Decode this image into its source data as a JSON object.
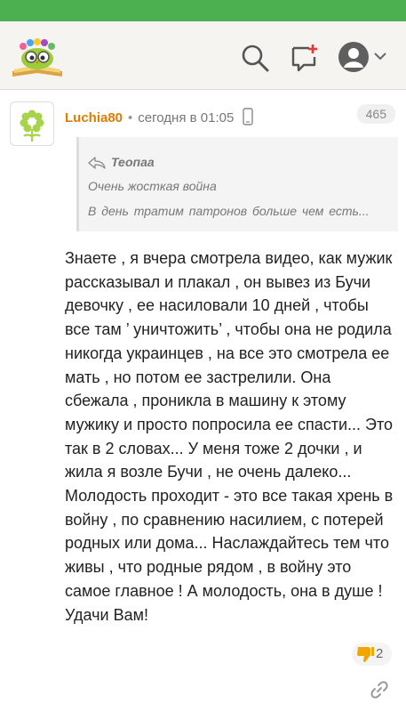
{
  "colors": {
    "status_bar": "#4caf50",
    "header_bg": "#f6f4f1",
    "author": "#e07b00",
    "text": "#222222",
    "meta": "#777777",
    "like_thumb": "#f2a400"
  },
  "header": {
    "icons": [
      "logo-owl-book",
      "search-icon",
      "add-comment-icon",
      "profile-avatar-icon",
      "chevron-down-icon"
    ]
  },
  "post": {
    "author": "Luchia80",
    "time": "сегодня в 01:05",
    "device_icon": "phone-icon",
    "badge": "465",
    "quote": {
      "author": "Теопаа",
      "line1": "Очень жосткая война",
      "line2": "В день тратим патронов больше чем есть..."
    },
    "body": "Знаете , я вчера смотрела видео, как мужик рассказывал и плакал , он вывез из Бучи девочку , ее насиловали 10 дней , чтобы все там ’ уничтожить’ , чтобы она не родила никогда украинцев , на все это смотрела ее мать , но потом ее застрелили. Она сбежала , проникла в машину к этому мужику и просто попросила ее спасти... Это так в 2 словах... У меня тоже 2 дочки , и жила я возле Бучи , не очень далеко... Молодость проходит - это все такая хрень в войну , по сравнению насилием, с потерей родных или дома... Наслаждайтесь тем что живы , что родные рядом , в войну это самое главное ! А молодость, она в душе ! Удачи Вам!",
    "likes": "2"
  }
}
